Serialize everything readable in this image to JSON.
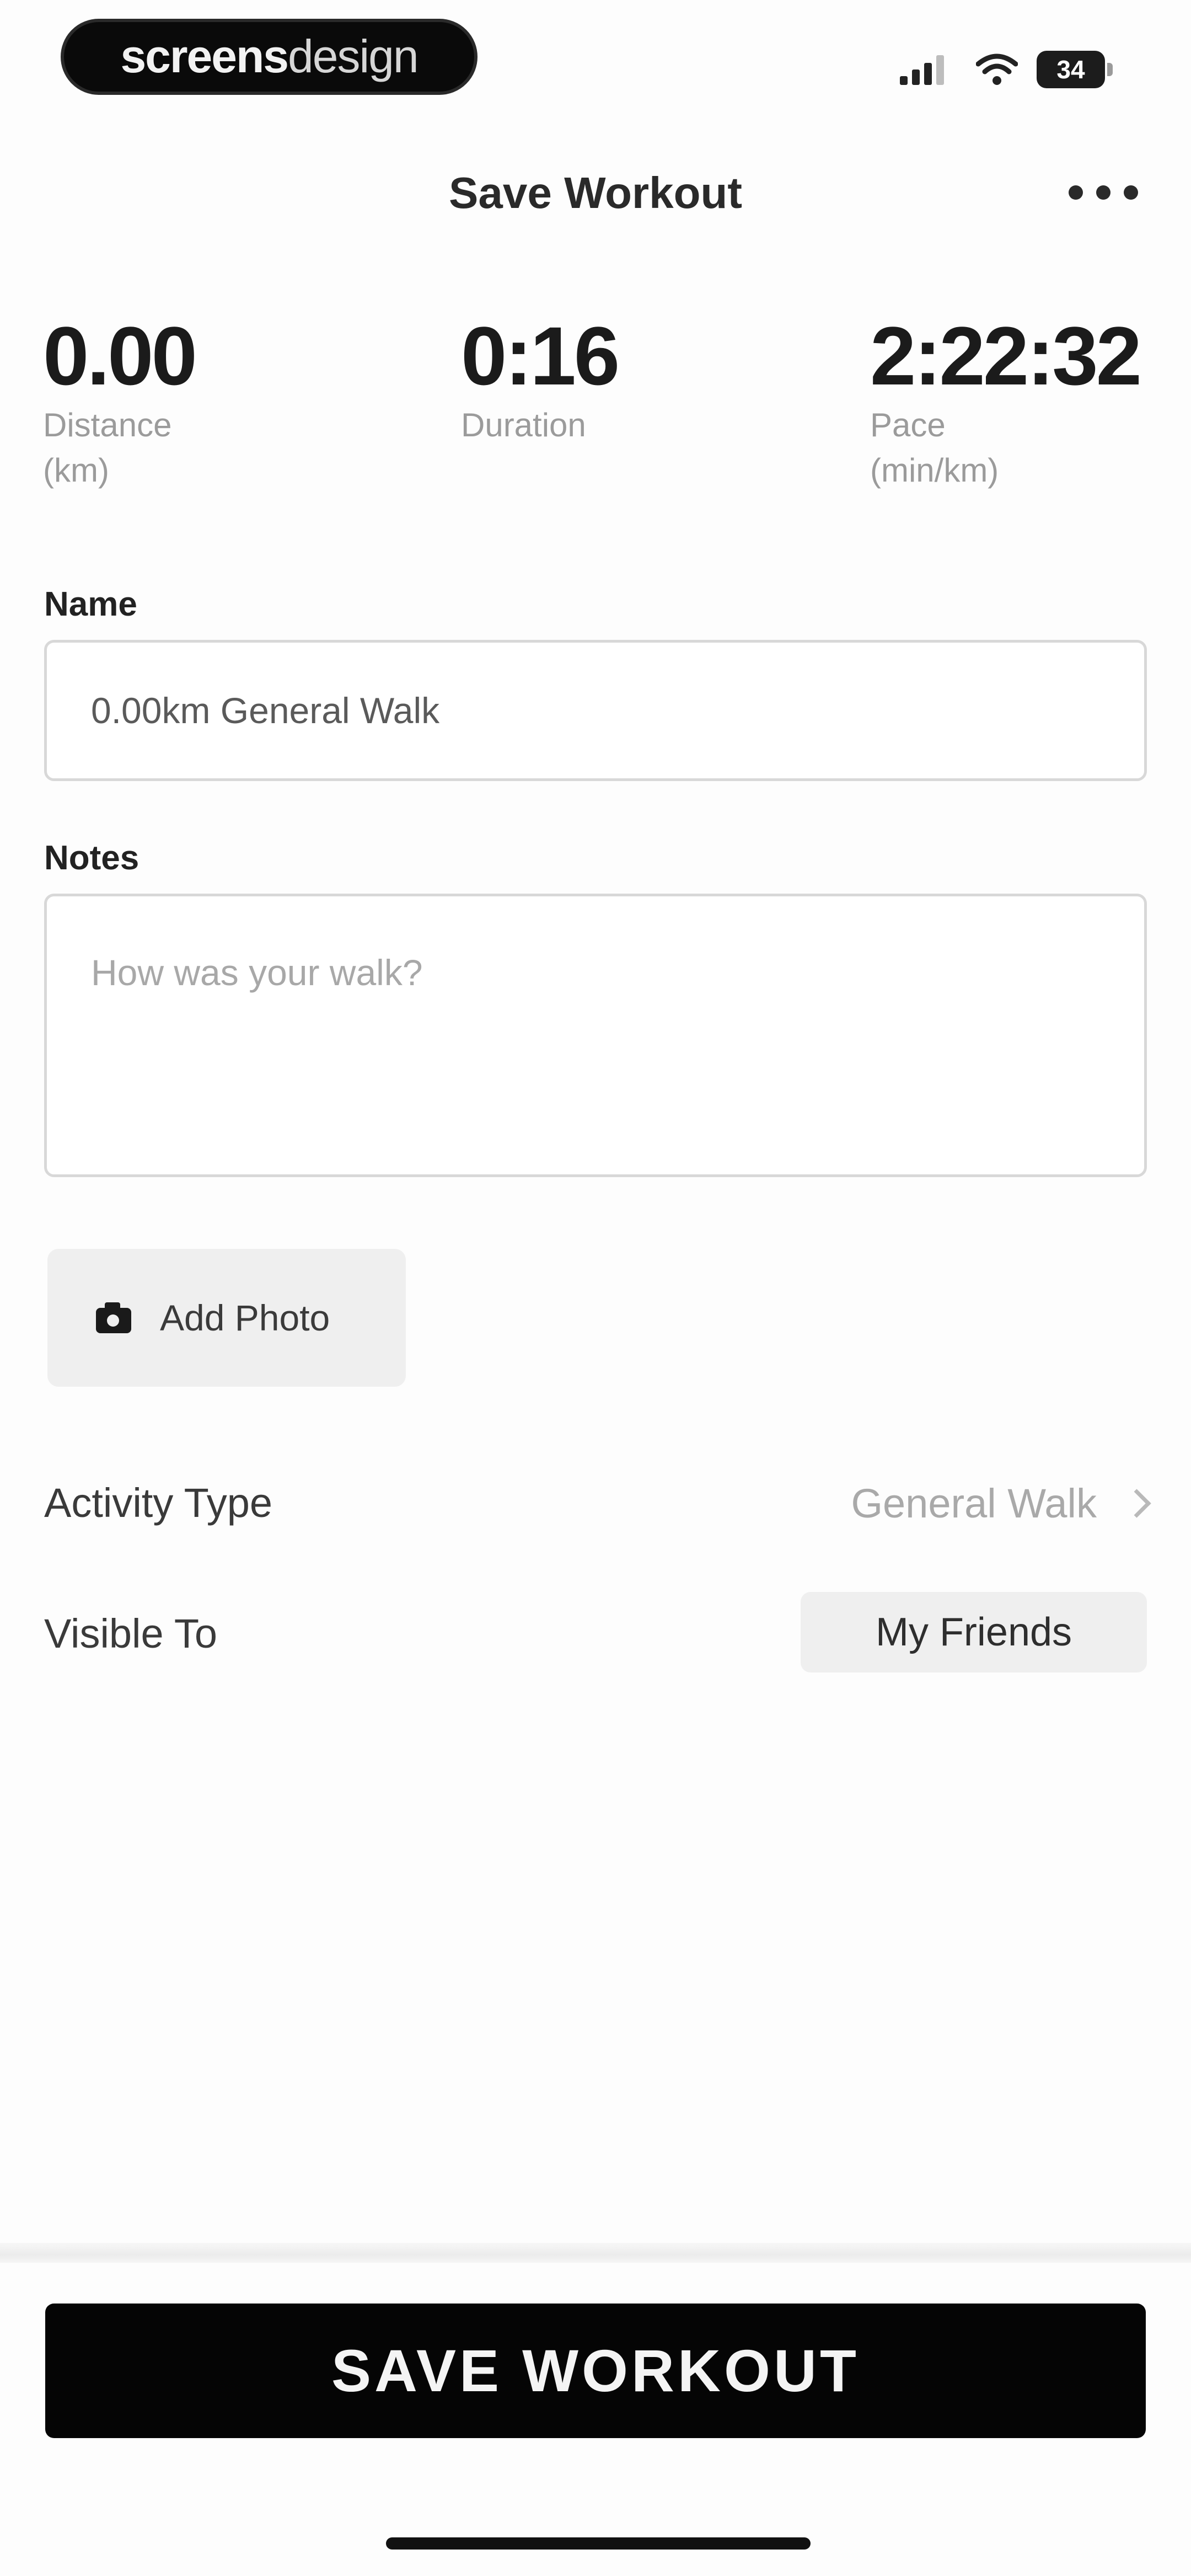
{
  "status_bar": {
    "brand_bold": "screens",
    "brand_light": "design",
    "battery_level": "34",
    "icons": [
      "signal-icon",
      "wifi-icon",
      "battery-icon"
    ]
  },
  "header": {
    "title": "Save Workout",
    "more_icon": "more-horizontal-icon"
  },
  "stats": [
    {
      "value": "0.00",
      "label": "Distance (km)"
    },
    {
      "value": "0:16",
      "label": "Duration"
    },
    {
      "value": "2:22:32",
      "label": "Pace (min/km)"
    }
  ],
  "form": {
    "name_label": "Name",
    "name_value": "0.00km General Walk",
    "notes_label": "Notes",
    "notes_placeholder": "How was your walk?",
    "notes_value": "",
    "add_photo_label": "Add Photo",
    "add_photo_icon": "camera-icon"
  },
  "settings": {
    "activity_type_label": "Activity Type",
    "activity_type_value": "General Walk",
    "visible_to_label": "Visible To",
    "visible_to_value": "My Friends"
  },
  "footer": {
    "save_label": "SAVE WORKOUT"
  },
  "colors": {
    "background": "#fdfdfd",
    "primary_button": "#050505",
    "muted_text": "#9b9b9b",
    "chip_background": "#efefef"
  }
}
